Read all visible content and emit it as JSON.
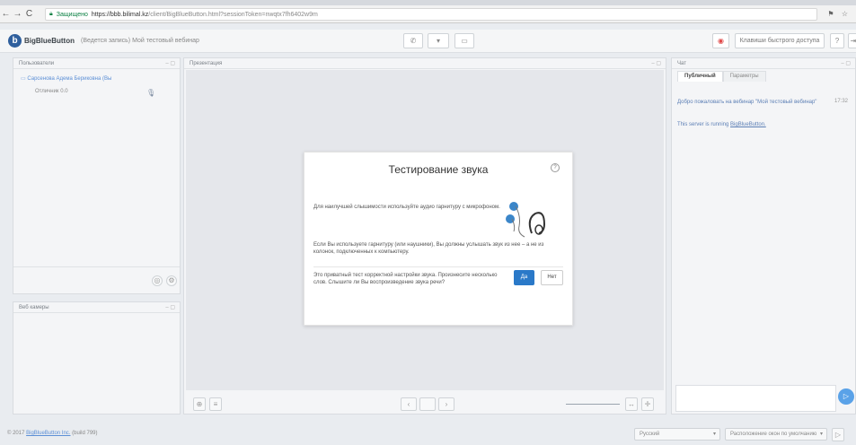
{
  "browser": {
    "secure_label": "Защищено",
    "url_host": "https://bbb.bilimal.kz",
    "url_path": "/client/BigBlueButton.html?sessionToken=nwqtx7fh6402w9m"
  },
  "header": {
    "brand": "BigBlueButton",
    "session_title": "(Ведется запись) Мой тестовый вебинар",
    "hotkeys_label": "Клавиши быстрого доступа"
  },
  "users_panel": {
    "title": "Пользователи",
    "user_name": "Сарсенова Адема Бериковна (Вы",
    "status": "Отличник 0.0"
  },
  "webcams_panel": {
    "title": "Веб камеры"
  },
  "presentation_panel": {
    "title": "Презентация"
  },
  "chat": {
    "title": "Чат",
    "tabs": [
      "Публичный",
      "Параметры"
    ],
    "time": "17:32",
    "welcome": "Добро пожаловать на вебинар \"Мой тестовый вебинар\"",
    "server_text": "This server is running",
    "server_link": "BigBlueButton."
  },
  "footer": {
    "copyright": "© 2017",
    "copyright_link": "BigBlueButton Inc.",
    "build": "(build 799)",
    "language": "Русский",
    "layout": "Расположение окон по умолчанию"
  },
  "modal": {
    "title": "Тестирование звука",
    "text1": "Для наилучшей слышимости используйте аудио гарнитуру с микрофоном.",
    "text2": "Если Вы используете гарнитуру (или наушники), Вы должны услышать звук из нее – а не из колонок, подключенных к компьютеру.",
    "text3": "Это приватный тест корректной настройки звука. Произнесите несколько слов. Слышите ли Вы воспроизведение звука речи?",
    "yes": "Да",
    "no": "Нет"
  },
  "colors": {
    "accent": "#2a79c8",
    "link": "#5c8fd6",
    "record": "#e04848"
  },
  "icons": [
    "back-icon",
    "forward-icon",
    "reload-icon",
    "lock-icon",
    "phone-icon",
    "monitor-icon",
    "record-icon",
    "help-icon",
    "headset-icon",
    "send-icon"
  ]
}
